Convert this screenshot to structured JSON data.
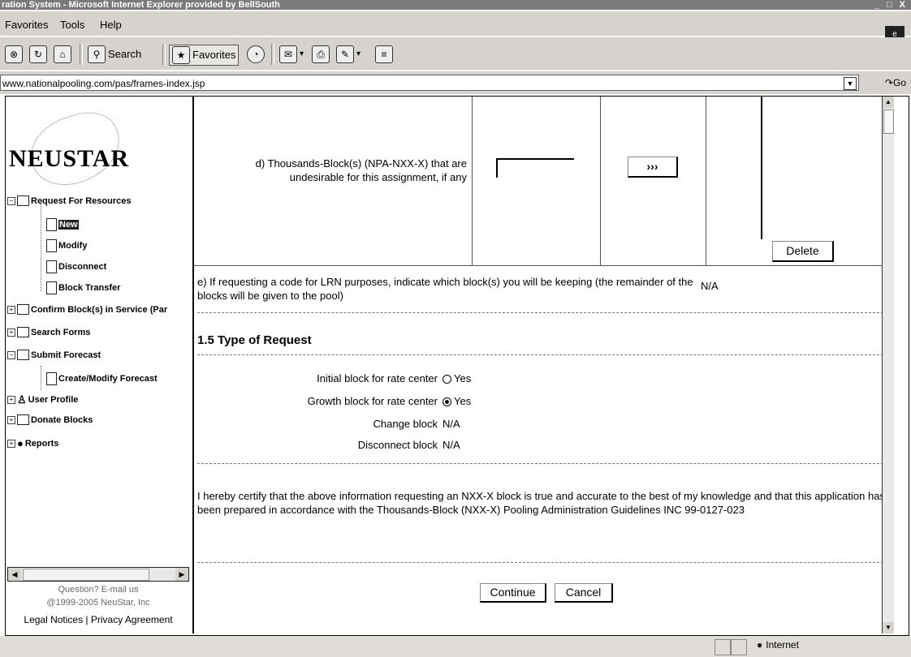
{
  "window": {
    "title": "ration System - Microsoft Internet Explorer provided by BellSouth",
    "controls": "_ □ X"
  },
  "menu": {
    "favorites": "Favorites",
    "tools": "Tools",
    "help": "Help"
  },
  "toolbar": {
    "search": "Search",
    "favorites": "Favorites"
  },
  "address": {
    "url": "www.nationalpooling.com/pas/frames-index.jsp",
    "go": "Go"
  },
  "sidebar": {
    "logo": "NEUSTAR",
    "items": [
      {
        "label": "Request For Resources"
      },
      {
        "label": "New"
      },
      {
        "label": "Modify"
      },
      {
        "label": "Disconnect"
      },
      {
        "label": "Block Transfer"
      },
      {
        "label": "Confirm Block(s) in Service (Par"
      },
      {
        "label": "Search Forms"
      },
      {
        "label": "Submit Forecast"
      },
      {
        "label": "Create/Modify Forecast"
      },
      {
        "label": "User Profile"
      },
      {
        "label": "Donate Blocks"
      },
      {
        "label": "Reports"
      }
    ],
    "question": "Question? E-mail us",
    "copyright": "@1999-2005 NeuStar, Inc",
    "legal": "Legal Notices | Privacy Agreement"
  },
  "form": {
    "d_label": "d) Thousands-Block(s) (NPA-NXX-X) that are undesirable for this assignment, if any",
    "add_btn": "›››",
    "delete_btn": "Delete",
    "e_label": "e) If requesting a code for LRN purposes, indicate which block(s) you will be keeping (the remainder of the blocks will be given to the pool)",
    "e_value": "N/A",
    "section_title": "1.5 Type of Request",
    "initial_label": "Initial block for rate center",
    "initial_value": "Yes",
    "growth_label": "Growth block for rate center",
    "growth_value": "Yes",
    "change_label": "Change block",
    "change_value": "N/A",
    "disconnect_label": "Disconnect block",
    "disconnect_value": "N/A",
    "certification": "I hereby certify that the above information requesting an NXX-X block is true and accurate to the best of my knowledge and that this application has been prepared in accordance with the Thousands-Block (NXX-X) Pooling Administration Guidelines INC 99-0127-023",
    "continue_btn": "Continue",
    "cancel_btn": "Cancel"
  },
  "status": {
    "zone": "Internet"
  }
}
